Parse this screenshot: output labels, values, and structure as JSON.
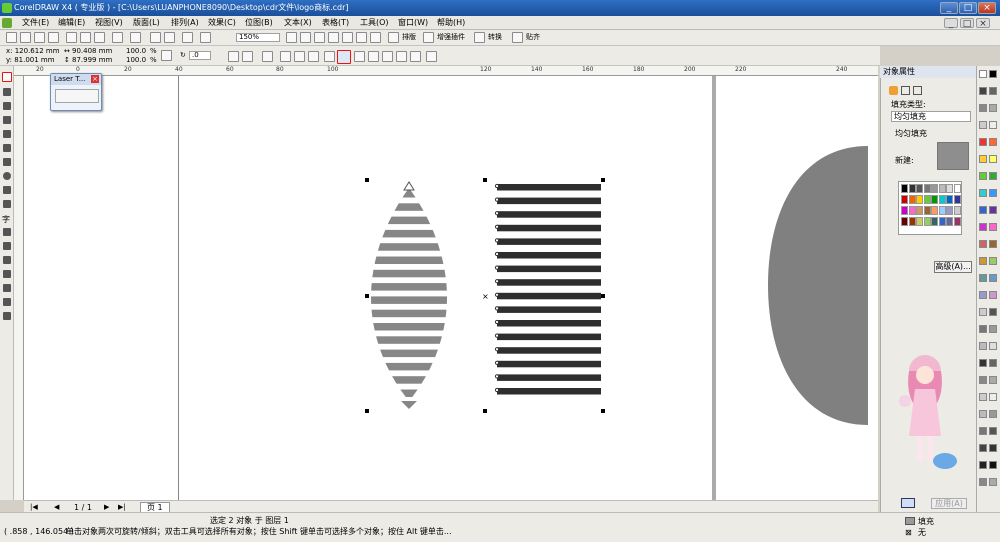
{
  "window": {
    "title": "CorelDRAW X4 ( 专业版 ) - [C:\\Users\\LUANPHONE8090\\Desktop\\cdr文件\\logo商标.cdr]"
  },
  "menu": [
    "文件(E)",
    "编辑(E)",
    "视图(V)",
    "版面(L)",
    "排列(A)",
    "效果(C)",
    "位图(B)",
    "文本(X)",
    "表格(T)",
    "工具(O)",
    "窗口(W)",
    "帮助(H)"
  ],
  "toolbar": {
    "zoom": "150%",
    "arrange_label": "排版",
    "plugins_label": "增强插件",
    "convert_label": "转换",
    "paste_label": "贴齐"
  },
  "props": {
    "x": "x: 120.612 mm",
    "y": "y: 81.001 mm",
    "width": "90.408 mm",
    "height": "87.999 mm",
    "scale_w": "100.0",
    "scale_h": "100.0",
    "pct": "%",
    "angle": ".0"
  },
  "ruler": {
    "h_ticks": [
      "20",
      "0",
      "20",
      "40",
      "60",
      "80",
      "100",
      "120",
      "140",
      "160",
      "180",
      "200",
      "220",
      "240"
    ]
  },
  "laser_toolbar": {
    "title": "Laser T..."
  },
  "page_nav": {
    "label": "1 / 1",
    "tab": "页 1"
  },
  "status": {
    "selection": "选定 2 对象 于 图层 1",
    "coords": "( .858 , 146.054 )",
    "hint": "单击对象两次可旋转/倾斜；双击工具可选择所有对象；按住 Shift 键单击可选择多个对象；按住 Alt 键单击...",
    "fill": "填充",
    "outline": "无"
  },
  "docker": {
    "title": "对象属性",
    "fill_type_label": "填充类型:",
    "fill_type_value": "均匀填充",
    "uniform_label": "均匀填充",
    "new_label": "新建:",
    "advanced_button": "高级(A)...",
    "apply_button": "应用(A)",
    "new_color": "#8e8e8e"
  },
  "colors": {
    "shape_fill": "#878787",
    "stripe_dark": "#2e2e2e",
    "bg_shape": "#808080"
  }
}
